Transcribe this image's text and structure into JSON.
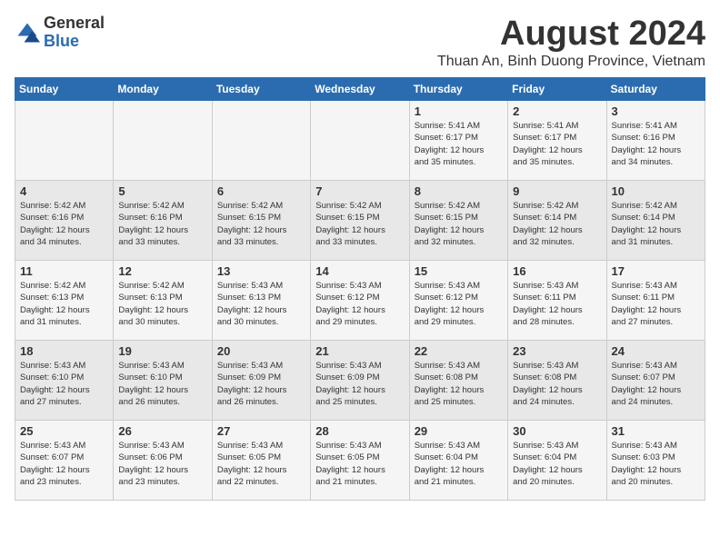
{
  "logo": {
    "general": "General",
    "blue": "Blue"
  },
  "title": {
    "month_year": "August 2024",
    "location": "Thuan An, Binh Duong Province, Vietnam"
  },
  "calendar": {
    "headers": [
      "Sunday",
      "Monday",
      "Tuesday",
      "Wednesday",
      "Thursday",
      "Friday",
      "Saturday"
    ],
    "weeks": [
      [
        {
          "day": "",
          "info": ""
        },
        {
          "day": "",
          "info": ""
        },
        {
          "day": "",
          "info": ""
        },
        {
          "day": "",
          "info": ""
        },
        {
          "day": "1",
          "info": "Sunrise: 5:41 AM\nSunset: 6:17 PM\nDaylight: 12 hours\nand 35 minutes."
        },
        {
          "day": "2",
          "info": "Sunrise: 5:41 AM\nSunset: 6:17 PM\nDaylight: 12 hours\nand 35 minutes."
        },
        {
          "day": "3",
          "info": "Sunrise: 5:41 AM\nSunset: 6:16 PM\nDaylight: 12 hours\nand 34 minutes."
        }
      ],
      [
        {
          "day": "4",
          "info": "Sunrise: 5:42 AM\nSunset: 6:16 PM\nDaylight: 12 hours\nand 34 minutes."
        },
        {
          "day": "5",
          "info": "Sunrise: 5:42 AM\nSunset: 6:16 PM\nDaylight: 12 hours\nand 33 minutes."
        },
        {
          "day": "6",
          "info": "Sunrise: 5:42 AM\nSunset: 6:15 PM\nDaylight: 12 hours\nand 33 minutes."
        },
        {
          "day": "7",
          "info": "Sunrise: 5:42 AM\nSunset: 6:15 PM\nDaylight: 12 hours\nand 33 minutes."
        },
        {
          "day": "8",
          "info": "Sunrise: 5:42 AM\nSunset: 6:15 PM\nDaylight: 12 hours\nand 32 minutes."
        },
        {
          "day": "9",
          "info": "Sunrise: 5:42 AM\nSunset: 6:14 PM\nDaylight: 12 hours\nand 32 minutes."
        },
        {
          "day": "10",
          "info": "Sunrise: 5:42 AM\nSunset: 6:14 PM\nDaylight: 12 hours\nand 31 minutes."
        }
      ],
      [
        {
          "day": "11",
          "info": "Sunrise: 5:42 AM\nSunset: 6:13 PM\nDaylight: 12 hours\nand 31 minutes."
        },
        {
          "day": "12",
          "info": "Sunrise: 5:42 AM\nSunset: 6:13 PM\nDaylight: 12 hours\nand 30 minutes."
        },
        {
          "day": "13",
          "info": "Sunrise: 5:43 AM\nSunset: 6:13 PM\nDaylight: 12 hours\nand 30 minutes."
        },
        {
          "day": "14",
          "info": "Sunrise: 5:43 AM\nSunset: 6:12 PM\nDaylight: 12 hours\nand 29 minutes."
        },
        {
          "day": "15",
          "info": "Sunrise: 5:43 AM\nSunset: 6:12 PM\nDaylight: 12 hours\nand 29 minutes."
        },
        {
          "day": "16",
          "info": "Sunrise: 5:43 AM\nSunset: 6:11 PM\nDaylight: 12 hours\nand 28 minutes."
        },
        {
          "day": "17",
          "info": "Sunrise: 5:43 AM\nSunset: 6:11 PM\nDaylight: 12 hours\nand 27 minutes."
        }
      ],
      [
        {
          "day": "18",
          "info": "Sunrise: 5:43 AM\nSunset: 6:10 PM\nDaylight: 12 hours\nand 27 minutes."
        },
        {
          "day": "19",
          "info": "Sunrise: 5:43 AM\nSunset: 6:10 PM\nDaylight: 12 hours\nand 26 minutes."
        },
        {
          "day": "20",
          "info": "Sunrise: 5:43 AM\nSunset: 6:09 PM\nDaylight: 12 hours\nand 26 minutes."
        },
        {
          "day": "21",
          "info": "Sunrise: 5:43 AM\nSunset: 6:09 PM\nDaylight: 12 hours\nand 25 minutes."
        },
        {
          "day": "22",
          "info": "Sunrise: 5:43 AM\nSunset: 6:08 PM\nDaylight: 12 hours\nand 25 minutes."
        },
        {
          "day": "23",
          "info": "Sunrise: 5:43 AM\nSunset: 6:08 PM\nDaylight: 12 hours\nand 24 minutes."
        },
        {
          "day": "24",
          "info": "Sunrise: 5:43 AM\nSunset: 6:07 PM\nDaylight: 12 hours\nand 24 minutes."
        }
      ],
      [
        {
          "day": "25",
          "info": "Sunrise: 5:43 AM\nSunset: 6:07 PM\nDaylight: 12 hours\nand 23 minutes."
        },
        {
          "day": "26",
          "info": "Sunrise: 5:43 AM\nSunset: 6:06 PM\nDaylight: 12 hours\nand 23 minutes."
        },
        {
          "day": "27",
          "info": "Sunrise: 5:43 AM\nSunset: 6:05 PM\nDaylight: 12 hours\nand 22 minutes."
        },
        {
          "day": "28",
          "info": "Sunrise: 5:43 AM\nSunset: 6:05 PM\nDaylight: 12 hours\nand 21 minutes."
        },
        {
          "day": "29",
          "info": "Sunrise: 5:43 AM\nSunset: 6:04 PM\nDaylight: 12 hours\nand 21 minutes."
        },
        {
          "day": "30",
          "info": "Sunrise: 5:43 AM\nSunset: 6:04 PM\nDaylight: 12 hours\nand 20 minutes."
        },
        {
          "day": "31",
          "info": "Sunrise: 5:43 AM\nSunset: 6:03 PM\nDaylight: 12 hours\nand 20 minutes."
        }
      ]
    ]
  }
}
